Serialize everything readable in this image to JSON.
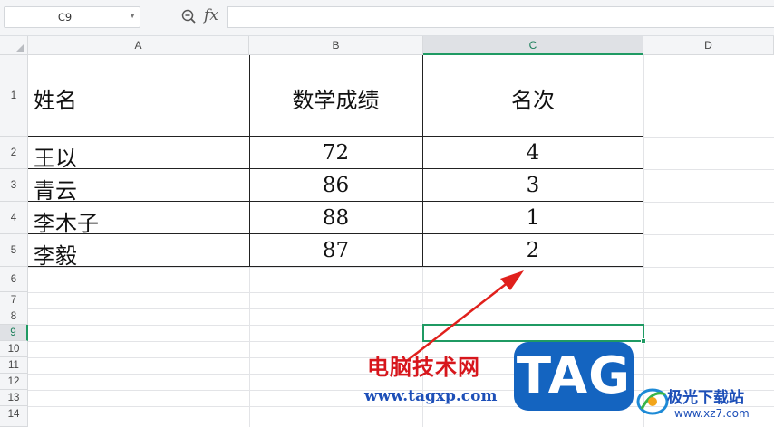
{
  "formula_bar": {
    "cell_ref": "C9",
    "fx_label": "fx",
    "formula_value": ""
  },
  "columns": [
    "A",
    "B",
    "C",
    "D"
  ],
  "rows": [
    "1",
    "2",
    "3",
    "4",
    "5",
    "6",
    "7",
    "8",
    "9",
    "10",
    "11",
    "12",
    "13",
    "14"
  ],
  "table": {
    "headers": [
      "姓名",
      "数学成绩",
      "名次"
    ],
    "records": [
      {
        "name": "王以",
        "score": "72",
        "rank": "4"
      },
      {
        "name": "青云",
        "score": "86",
        "rank": "3"
      },
      {
        "name": "李木子",
        "score": "88",
        "rank": "1"
      },
      {
        "name": "李毅",
        "score": "87",
        "rank": "2"
      }
    ]
  },
  "selection": {
    "active_column": "C",
    "active_row": "9"
  },
  "watermark": {
    "site_name": "电脑技术网",
    "site_url": "www.tagxp.com",
    "tag_logo": "TAG",
    "jiguang_title": "极光下载站",
    "jiguang_url": "www.xz7.com"
  },
  "colors": {
    "selection_green": "#1f9a63",
    "annotation_red": "#e0201c",
    "watermark_red": "#d7161c",
    "watermark_blue": "#1464c0"
  },
  "icons": [
    "zoom-formula-icon",
    "dropdown-arrow-icon",
    "annotation-arrow-icon",
    "select-all-icon"
  ]
}
